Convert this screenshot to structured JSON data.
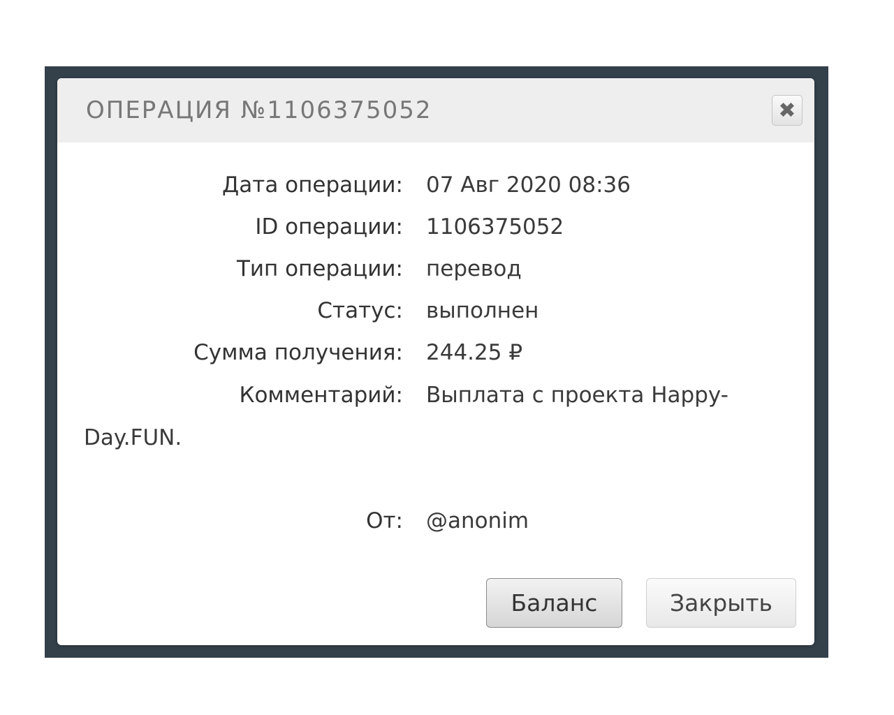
{
  "dialog": {
    "title": "ОПЕРАЦИЯ №1106375052",
    "close_icon": "close-icon",
    "fields": {
      "date": {
        "label": "Дата операции:",
        "value": "07 Авг 2020 08:36"
      },
      "id": {
        "label": "ID операции:",
        "value": "1106375052"
      },
      "type": {
        "label": "Тип операции:",
        "value": "перевод"
      },
      "status": {
        "label": "Статус:",
        "value": "выполнен"
      },
      "amount": {
        "label": "Сумма получения:",
        "value": "244.25 ₽"
      },
      "comment": {
        "label": "Комментарий:",
        "value_line1": "Выплата с проекта Happy-",
        "value_line2": "Day.FUN."
      },
      "from": {
        "label": "От:",
        "value": "@anonim"
      }
    },
    "buttons": {
      "balance": "Баланс",
      "close": "Закрыть"
    }
  },
  "colors": {
    "backdrop": "#34404a",
    "header_bg": "#eeeeee",
    "title_text": "#777777"
  }
}
